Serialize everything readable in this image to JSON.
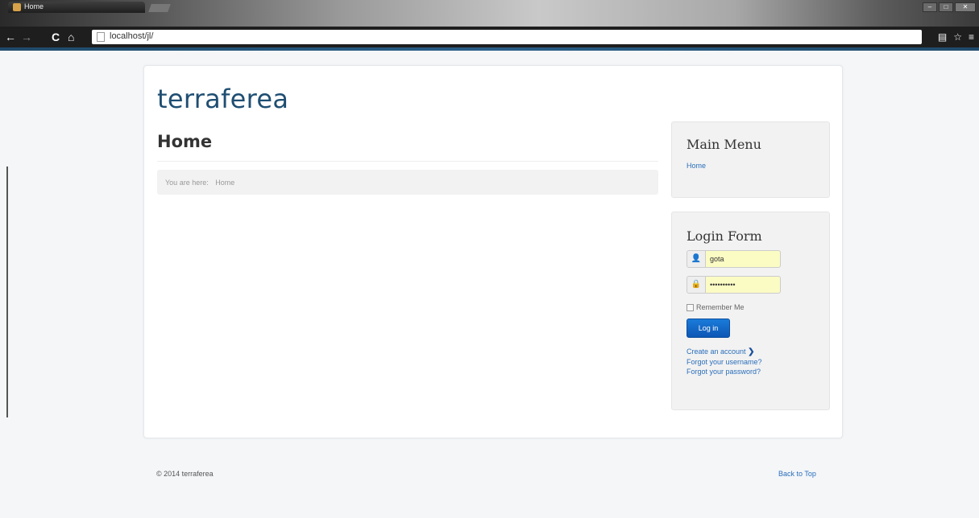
{
  "browser": {
    "tab_title": "Home",
    "url": "localhost/jl/",
    "icons": [
      "back-icon",
      "forward-icon",
      "reload-icon",
      "home-icon",
      "page-icon",
      "star-icon",
      "menu-icon"
    ]
  },
  "site": {
    "brand": "terraferea"
  },
  "main": {
    "page_title": "Home",
    "breadcrumb_prefix": "You are here:",
    "breadcrumb_current": "Home"
  },
  "sidebar": {
    "menu": {
      "title": "Main Menu",
      "items": [
        {
          "label": "Home"
        }
      ]
    },
    "login": {
      "title": "Login Form",
      "username_value": "gota",
      "password_value": "••••••••••",
      "remember_label": "Remember Me",
      "button_label": "Log in",
      "create_account": "Create an account",
      "forgot_username": "Forgot your username?",
      "forgot_password": "Forgot your password?"
    }
  },
  "footer": {
    "copyright": "© 2014 terraferea",
    "back_to_top": "Back to Top"
  },
  "colors": {
    "brand": "#1f4e72",
    "link": "#2a6ebb",
    "button": "#0d57b5",
    "autofill": "#fbfbc4"
  }
}
